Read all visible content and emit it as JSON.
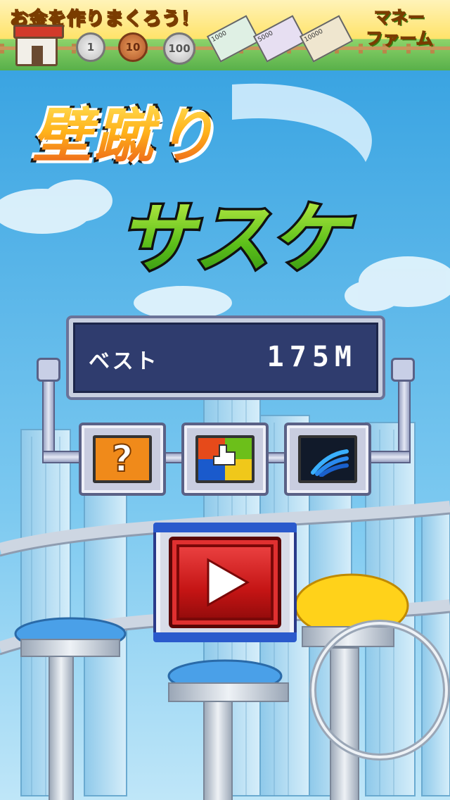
{
  "ad_banner": {
    "headline": "お金を作りまくろう！",
    "coins": [
      "1",
      "10",
      "100"
    ],
    "bills": [
      "1000",
      "5000",
      "10000"
    ],
    "logo_line1": "マネー",
    "logo_line2": "ファーム"
  },
  "title": {
    "line1": "壁蹴り",
    "line2": "サスケ"
  },
  "best": {
    "label": "ベスト",
    "value": "175M"
  },
  "menu": {
    "help_glyph": "?",
    "icons": [
      "question-icon",
      "share-icon",
      "signal-icon"
    ]
  },
  "play": {
    "icon": "play-icon"
  },
  "colors": {
    "sky": "#4fb3e6",
    "title_orange": "#ffb21a",
    "title_green": "#5cbf1a",
    "panel": "#2f3c6e",
    "play_red": "#c41414",
    "frame_blue": "#2a5acc"
  }
}
